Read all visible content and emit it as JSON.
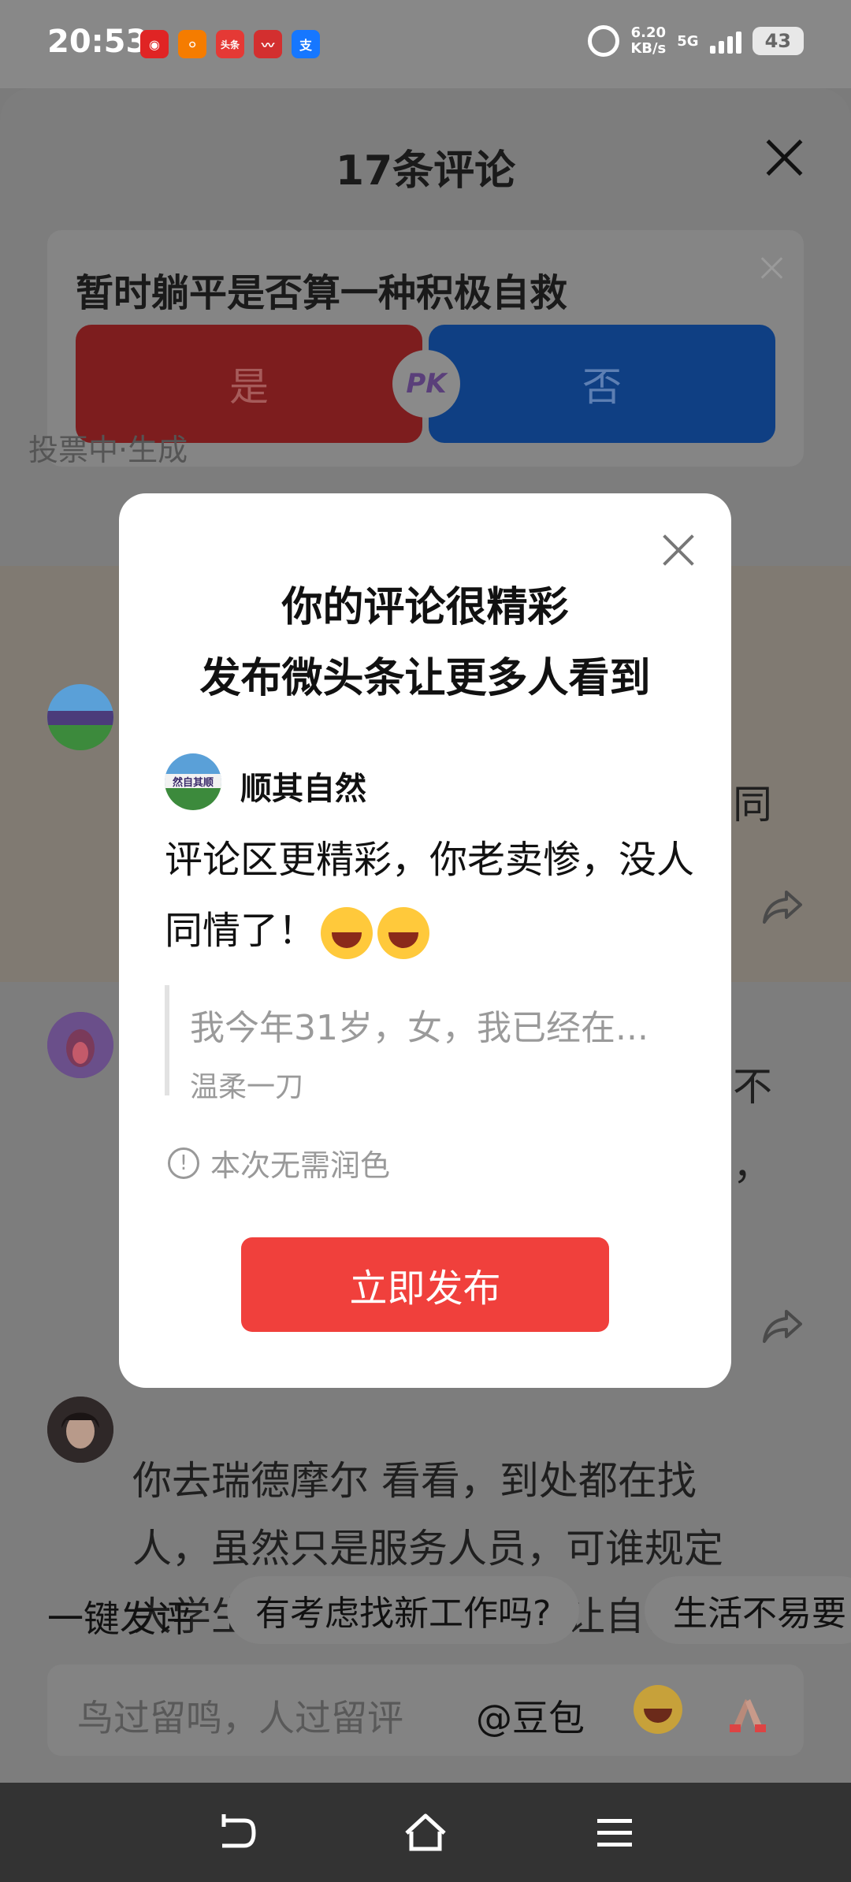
{
  "status_bar": {
    "time": "20:53",
    "apps": [
      {
        "name": "netease-music",
        "glyph": "◉",
        "color": "#e02424"
      },
      {
        "name": "meituan",
        "glyph": "ဝ",
        "color": "#f57c00"
      },
      {
        "name": "toutiao",
        "glyph": "头条",
        "color": "#e53935"
      },
      {
        "name": "stock-app",
        "glyph": "〰",
        "color": "#d32f2f"
      },
      {
        "name": "alipay",
        "glyph": "支",
        "color": "#1677ff"
      }
    ],
    "net_speed_value": "6.20",
    "net_speed_unit": "KB/s",
    "network": "5G",
    "battery": "43"
  },
  "sheet": {
    "title": "17条评论",
    "poll": {
      "question": "暂时躺平是否算一种积极自救",
      "option_yes": "是",
      "option_no": "否",
      "pk_label": "PK",
      "status": "投票中·生成"
    },
    "comments": [
      {
        "visible_text": "同"
      },
      {
        "visible_text_1": "不",
        "visible_text_2": "，"
      },
      {
        "lines": [
          "你去瑞德摩尔 看看，到处都在找",
          "人，虽然只是服务人员，可谁规定",
          "大学生就不能做这些，先让自己吃"
        ]
      }
    ]
  },
  "popup": {
    "title_line1": "你的评论很精彩",
    "title_line2": "发布微头条让更多人看到",
    "username": "顺其自然",
    "avatar_text": "然自其顺",
    "comment": "评论区更精彩，你老卖惨，没人同情了！",
    "quote_text": "我今年31岁，女，我已经在...",
    "quote_author": "温柔一刀",
    "note": "本次无需润色",
    "publish_label": "立即发布"
  },
  "quick_reply": {
    "label": "一键发评",
    "chips": [
      "有考虑找新工作吗?",
      "生活不易要"
    ]
  },
  "input_bar": {
    "placeholder": "鸟过留鸣，人过留评",
    "mention": "@豆包"
  }
}
